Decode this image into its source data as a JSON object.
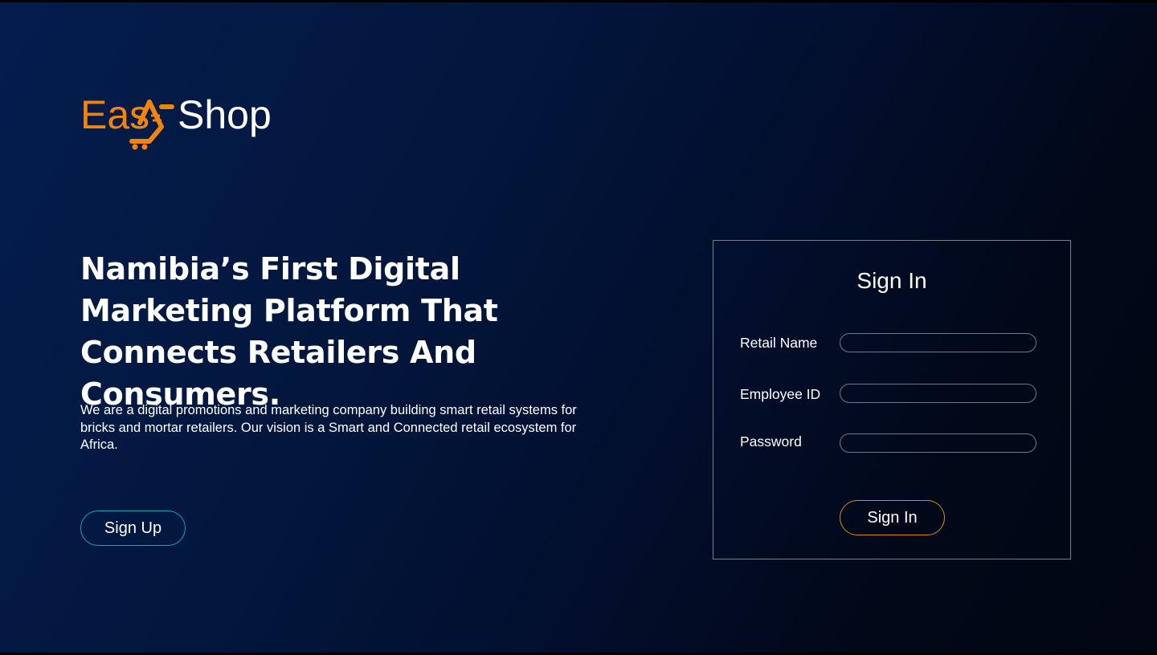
{
  "brand": {
    "logo_text_part1": "Eas",
    "logo_text_part2": "Shop",
    "logo_icon": "shopping-cart-icon",
    "logo_accent_color": "#f0840c",
    "logo_text_color": "#ffffff"
  },
  "hero": {
    "headline": "Namibia’s First Digital Marketing Platform That Connects Retailers And Consumers.",
    "description": "We are a digital promotions and marketing company building smart retail systems for bricks and mortar retailers. Our vision is a Smart and Connected retail ecosystem for Africa.",
    "signup_label": "Sign Up",
    "signup_border_color": "#17a4b4"
  },
  "signin": {
    "title": "Sign In",
    "fields": [
      {
        "label": "Retail Name",
        "value": "",
        "placeholder": ""
      },
      {
        "label": "Employee ID",
        "value": "",
        "placeholder": ""
      },
      {
        "label": "Password",
        "value": "",
        "placeholder": ""
      }
    ],
    "submit_label": "Sign In",
    "submit_border_color": "#d98a1f"
  },
  "colors": {
    "background_start": "#041d4f",
    "background_end": "#010611"
  }
}
